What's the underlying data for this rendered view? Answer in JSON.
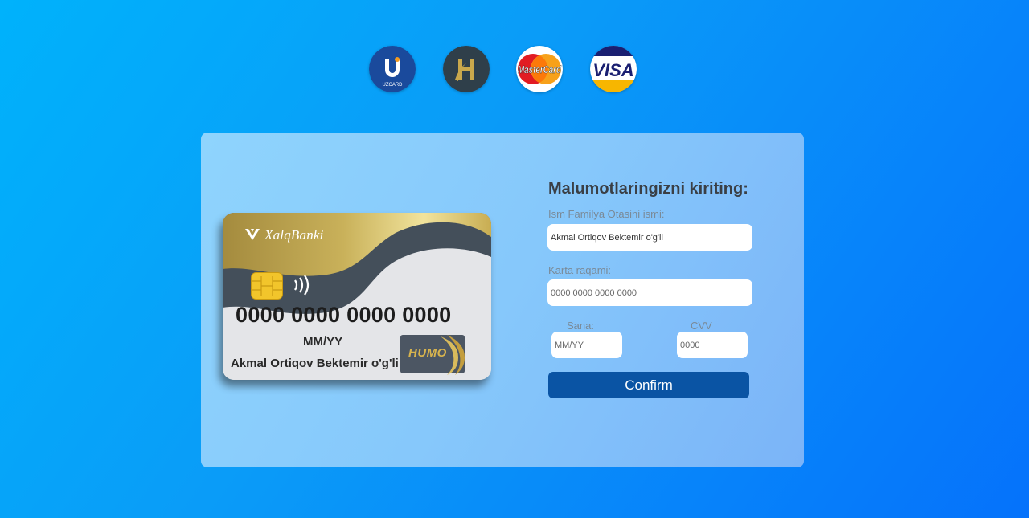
{
  "logos": [
    {
      "name": "uzcard",
      "text": "UZCARD"
    },
    {
      "name": "humo",
      "text": "H"
    },
    {
      "name": "mastercard",
      "text": "MasterCard"
    },
    {
      "name": "visa",
      "text": "VISA"
    }
  ],
  "card": {
    "bank_name": "XalqBanki",
    "number": "0000 0000 0000 0000",
    "expiry": "MM/YY",
    "holder": "Akmal Ortiqov Bektemir o'g'li",
    "brand": "HUMO"
  },
  "form": {
    "title": "Malumotlaringizni kiriting:",
    "name_label": "Ism Familya Otasini ismi:",
    "name_value": "Akmal Ortiqov Bektemir o'g'li",
    "card_label": "Karta raqami:",
    "card_placeholder": "0000 0000 0000 0000",
    "date_label": "Sana:",
    "date_placeholder": "MM/YY",
    "cvv_label": "CVV",
    "cvv_placeholder": "0000",
    "confirm_label": "Confirm"
  },
  "colors": {
    "accent": "#0a54a4",
    "card_gold": "#c9b15a",
    "card_dark": "#444f5a"
  }
}
